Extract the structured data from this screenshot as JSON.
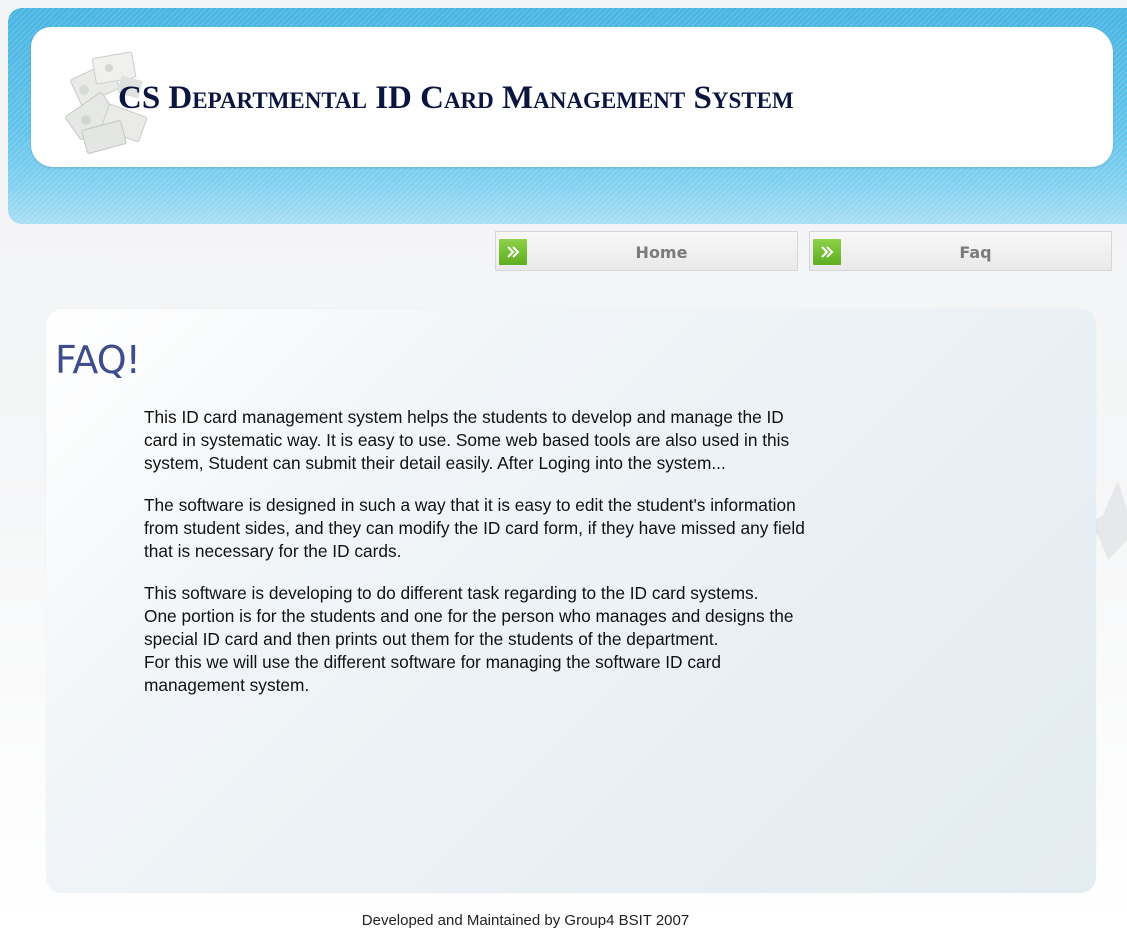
{
  "header": {
    "site_title": "CS Departmental ID Card Management System",
    "logo_icon": "id-cards-logo"
  },
  "nav": {
    "items": [
      {
        "label": "Home",
        "icon": "double-chevron-right-icon"
      },
      {
        "label": "Faq",
        "icon": "double-chevron-right-icon"
      }
    ],
    "accent_color": "#6dbf2e"
  },
  "main": {
    "heading": "FAQ!",
    "paragraphs": [
      "This ID card management system helps the students to develop and manage the ID\ncard in systematic way. It is easy to use. Some web based tools are also used in this\nsystem, Student can submit their detail easily. After Loging into the system...",
      "The software is designed in such a way that it is easy to edit the student's information\nfrom student sides, and they can modify the ID card form, if they have missed any field\nthat is necessary for the ID cards.",
      "This software is developing to do different task regarding to the ID card systems.\nOne portion is for the students and one for the person who manages and designs the\nspecial ID card and then prints out them for the students of the department.\nFor this we will use the different software for managing the software ID card\nmanagement system."
    ]
  },
  "footer": {
    "text": "Developed and Maintained by Group4 BSIT 2007"
  },
  "colors": {
    "header_blue": "#5bbde6",
    "title_color": "#0b1640",
    "heading_color": "#3f4c8e"
  }
}
